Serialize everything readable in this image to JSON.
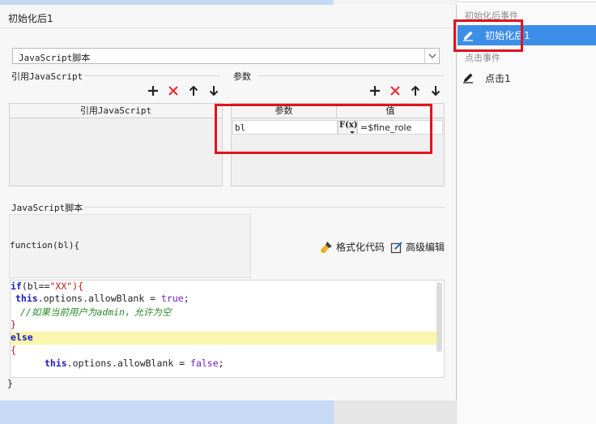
{
  "dialog": {
    "title": "初始化后1",
    "script_type": "JavaScript脚本",
    "ref_js_group_label": "引用JavaScript",
    "ref_js_column": "引用JavaScript",
    "params_group_label": "参数",
    "params_columns": [
      "参数",
      "值"
    ],
    "params_rows": [
      {
        "name": "bl",
        "fx_label": "F(x)",
        "value": "=$fine_role"
      }
    ],
    "script_group_label": "JavaScript脚本",
    "function_signature": "function(bl){",
    "format_code_label": "格式化代码",
    "advanced_edit_label": "高级编辑",
    "closing_brace": "}"
  },
  "code": {
    "l1_kw": "if",
    "l1_open": "(bl==",
    "l1_str": "\"XX\"",
    "l1_close": "){",
    "l2_kw": "this",
    "l2_rest": ".options.allowBlank = ",
    "l2_lit": "true",
    "l2_end": ";",
    "l3_comment_a": "//如果当前用户为",
    "l3_comment_b": "admin",
    "l3_comment_c": "，允许为空",
    "l4": "}",
    "l5_kw": "else",
    "l6": "{",
    "l7_kw": "this",
    "l7_rest": ".options.allowBlank = ",
    "l7_lit": "false",
    "l7_end": ";"
  },
  "event_panel": {
    "section_init": "初始化后事件",
    "init_item": "初始化后1",
    "section_click": "点击事件",
    "click_item": "点击1"
  },
  "colors": {
    "accent": "#3d8ee8",
    "highlight_red": "#e0141e",
    "delete_red": "#e8322e",
    "code_highlight": "#fbf6ae"
  },
  "icons": {
    "add": "plus-icon",
    "delete": "cross-icon",
    "up": "arrow-up-icon",
    "down": "arrow-down-icon",
    "edit": "pencil-icon",
    "format": "brush-icon",
    "advanced": "edit-box-icon",
    "dropdown": "chevron-down-icon"
  }
}
